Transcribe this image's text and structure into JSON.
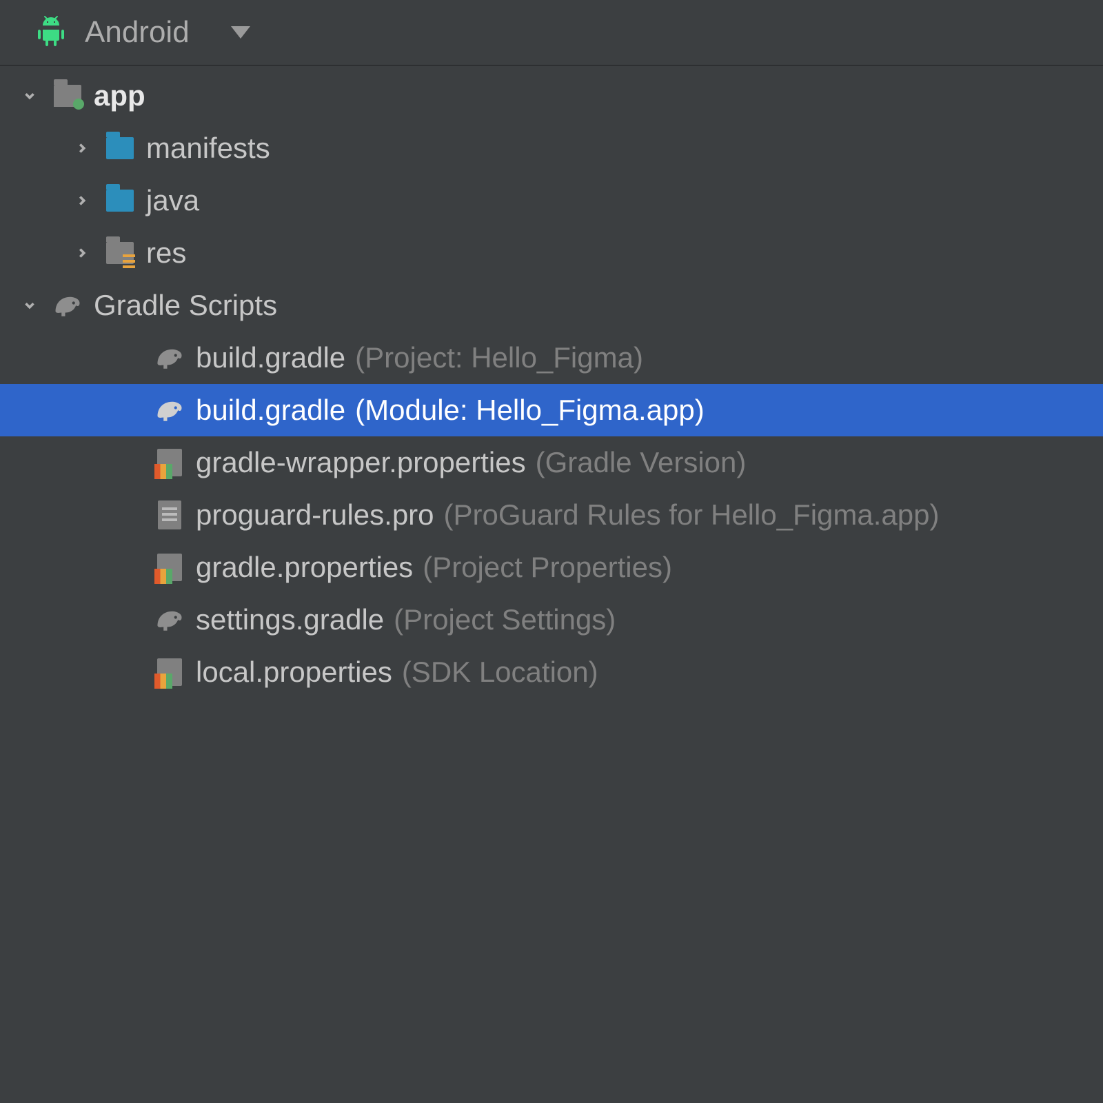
{
  "header": {
    "title": "Android"
  },
  "tree": {
    "app": {
      "label": "app",
      "children": {
        "manifests": "manifests",
        "java": "java",
        "res": "res"
      }
    },
    "gradle_scripts": {
      "label": "Gradle Scripts",
      "files": [
        {
          "name": "build.gradle",
          "suffix": "(Project: Hello_Figma)",
          "icon": "elephant",
          "selected": false
        },
        {
          "name": "build.gradle",
          "suffix": "(Module: Hello_Figma.app)",
          "icon": "elephant",
          "selected": true
        },
        {
          "name": "gradle-wrapper.properties",
          "suffix": "(Gradle Version)",
          "icon": "properties",
          "selected": false
        },
        {
          "name": "proguard-rules.pro",
          "suffix": "(ProGuard Rules for Hello_Figma.app)",
          "icon": "textfile",
          "selected": false
        },
        {
          "name": "gradle.properties",
          "suffix": "(Project Properties)",
          "icon": "properties",
          "selected": false
        },
        {
          "name": "settings.gradle",
          "suffix": "(Project Settings)",
          "icon": "elephant",
          "selected": false
        },
        {
          "name": "local.properties",
          "suffix": "(SDK Location)",
          "icon": "properties",
          "selected": false
        }
      ]
    }
  }
}
